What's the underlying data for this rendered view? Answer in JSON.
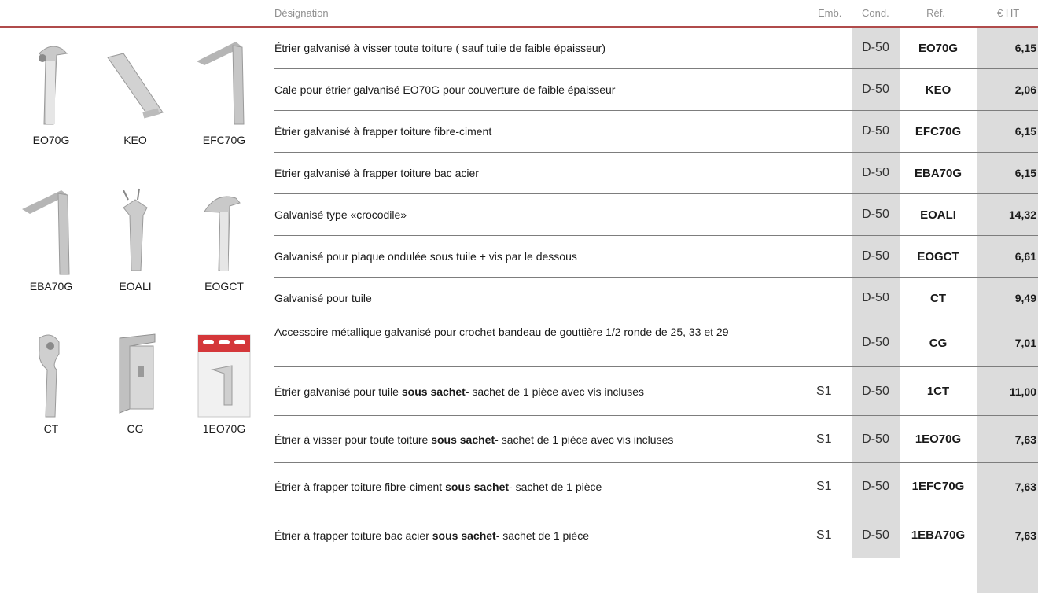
{
  "header": {
    "designation": "Désignation",
    "emb": "Emb.",
    "cond": "Cond.",
    "ref": "Réf.",
    "price": "€ HT"
  },
  "products": [
    {
      "label": "EO70G",
      "icon": "stirrup-screw-icon"
    },
    {
      "label": "KEO",
      "icon": "shim-icon"
    },
    {
      "label": "EFC70G",
      "icon": "stirrup-long-icon"
    },
    {
      "label": "EBA70G",
      "icon": "stirrup-long-icon"
    },
    {
      "label": "EOALI",
      "icon": "crocodile-clip-icon"
    },
    {
      "label": "EOGCT",
      "icon": "stirrup-screw-icon"
    },
    {
      "label": "CT",
      "icon": "stirrup-tile-icon"
    },
    {
      "label": "CG",
      "icon": "gutter-bracket-icon"
    },
    {
      "label": "1EO70G",
      "icon": "sachet-icon"
    }
  ],
  "rows": [
    {
      "desc": "Étrier galvanisé à visser toute toiture ( sauf tuile de faible épaisseur)",
      "emb": "",
      "cond": "D-50",
      "ref": "EO70G",
      "price": "6,15"
    },
    {
      "desc": "Cale pour étrier galvanisé EO70G pour couverture de faible épaisseur",
      "emb": "",
      "cond": "D-50",
      "ref": "KEO",
      "price": "2,06"
    },
    {
      "desc": "Étrier galvanisé à frapper toiture fibre-ciment",
      "emb": "",
      "cond": "D-50",
      "ref": "EFC70G",
      "price": "6,15"
    },
    {
      "desc": "Étrier galvanisé à frapper toiture bac acier",
      "emb": "",
      "cond": "D-50",
      "ref": "EBA70G",
      "price": "6,15"
    },
    {
      "desc": "Galvanisé type «crocodile»",
      "emb": "",
      "cond": "D-50",
      "ref": "EOALI",
      "price": "14,32"
    },
    {
      "desc": "Galvanisé pour plaque ondulée sous tuile + vis par le dessous",
      "emb": "",
      "cond": "D-50",
      "ref": "EOGCT",
      "price": "6,61"
    },
    {
      "desc": "Galvanisé pour tuile",
      "emb": "",
      "cond": "D-50",
      "ref": "CT",
      "price": "9,49"
    },
    {
      "desc": "Accessoire métallique galvanisé pour crochet bandeau de gouttière 1/2 ronde de 25, 33 et 29",
      "emb": "",
      "cond": "D-50",
      "ref": "CG",
      "price": "7,01"
    },
    {
      "desc_pre": "Étrier galvanisé pour tuile ",
      "desc_bold": "sous sachet",
      "desc_post": " - sachet de 1 pièce avec vis incluses",
      "emb": "S1",
      "cond": "D-50",
      "ref": "1CT",
      "price": "11,00"
    },
    {
      "desc_pre": "Étrier à visser pour toute toiture ",
      "desc_bold": "sous sachet",
      "desc_post": " - sachet de 1 pièce avec vis incluses",
      "emb": "S1",
      "cond": "D-50",
      "ref": "1EO70G",
      "price": "7,63"
    },
    {
      "desc_pre": "Étrier à frapper toiture fibre-ciment ",
      "desc_bold": "sous sachet",
      "desc_post": " - sachet de 1 pièce",
      "emb": "S1",
      "cond": "D-50",
      "ref": "1EFC70G",
      "price": "7,63"
    },
    {
      "desc_pre": "Étrier à frapper toiture bac acier ",
      "desc_bold": "sous sachet",
      "desc_post": "- sachet de 1 pièce",
      "emb": "S1",
      "cond": "D-50",
      "ref": "1EBA70G",
      "price": "7,63"
    }
  ]
}
